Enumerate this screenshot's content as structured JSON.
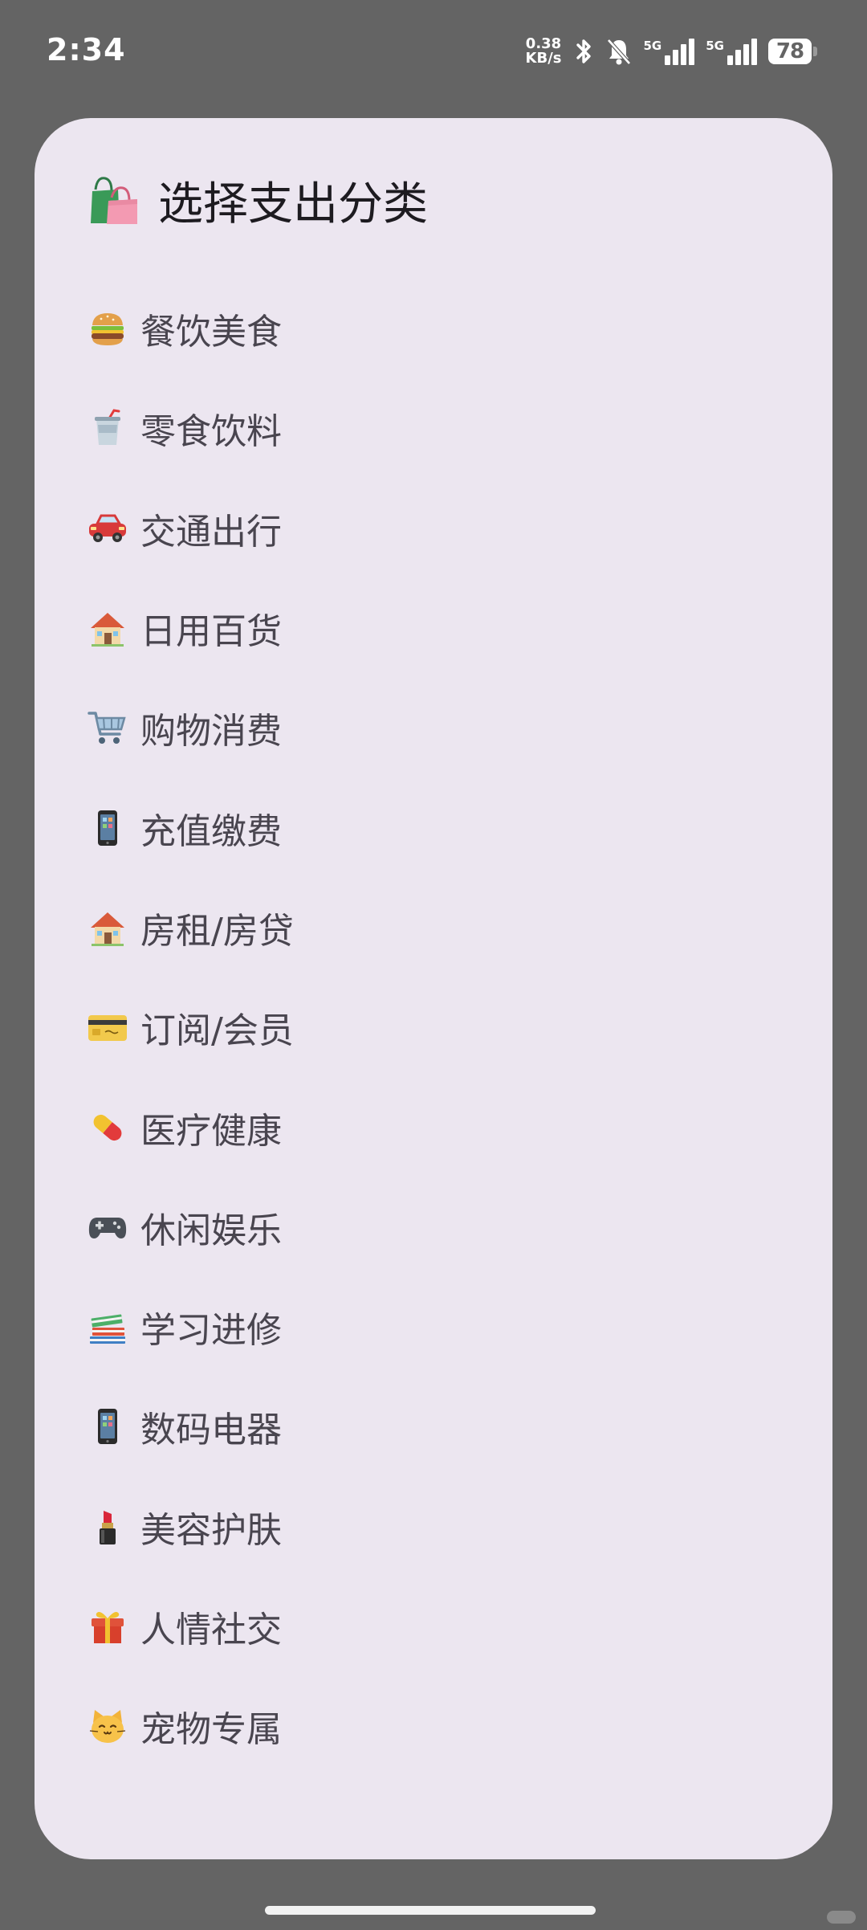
{
  "status_bar": {
    "time": "2:34",
    "net_speed_value": "0.38",
    "net_speed_unit": "KB/s",
    "network_1": "5G",
    "network_2": "5G",
    "battery_level": "78"
  },
  "sheet": {
    "title": "选择支出分类",
    "title_icon": "shopping-bags-icon",
    "categories": [
      {
        "label": "餐饮美食",
        "icon": "burger-icon"
      },
      {
        "label": "零食饮料",
        "icon": "cup-with-straw-icon"
      },
      {
        "label": "交通出行",
        "icon": "car-icon"
      },
      {
        "label": "日用百货",
        "icon": "house-icon"
      },
      {
        "label": "购物消费",
        "icon": "shopping-cart-icon"
      },
      {
        "label": "充值缴费",
        "icon": "mobile-phone-icon"
      },
      {
        "label": "房租/房贷",
        "icon": "house-icon"
      },
      {
        "label": "订阅/会员",
        "icon": "credit-card-icon"
      },
      {
        "label": "医疗健康",
        "icon": "pill-icon"
      },
      {
        "label": "休闲娱乐",
        "icon": "game-controller-icon"
      },
      {
        "label": "学习进修",
        "icon": "books-icon"
      },
      {
        "label": "数码电器",
        "icon": "mobile-phone-icon"
      },
      {
        "label": "美容护肤",
        "icon": "lipstick-icon"
      },
      {
        "label": "人情社交",
        "icon": "gift-icon"
      },
      {
        "label": "宠物专属",
        "icon": "cat-face-icon"
      }
    ]
  },
  "colors": {
    "backdrop": "#646464",
    "sheet_background": "#ece6f0",
    "title_text": "#1d1b20",
    "item_text": "#49454f"
  }
}
